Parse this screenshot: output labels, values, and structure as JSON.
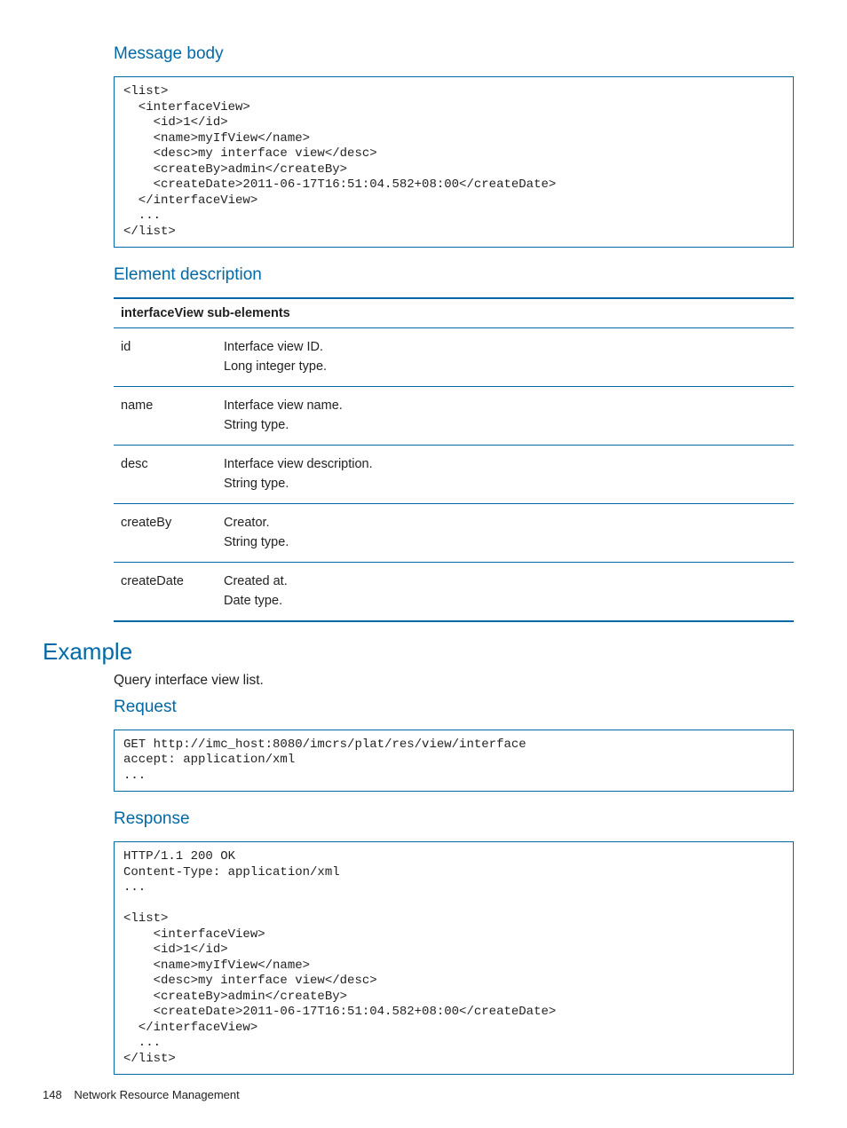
{
  "sections": {
    "msgBodyTitle": "Message body",
    "msgBodyCode": "<list>\n  <interfaceView>\n    <id>1</id>\n    <name>myIfView</name>\n    <desc>my interface view</desc>\n    <createBy>admin</createBy>\n    <createDate>2011-06-17T16:51:04.582+08:00</createDate>\n  </interfaceView>\n  ...\n</list>",
    "elemDescTitle": "Element description",
    "tableHeader": "interfaceView sub-elements",
    "rows": [
      {
        "k": "id",
        "v": "Interface view ID.\nLong integer type."
      },
      {
        "k": "name",
        "v": "Interface view name.\nString type."
      },
      {
        "k": "desc",
        "v": "Interface view description.\nString type."
      },
      {
        "k": "createBy",
        "v": "Creator.\nString type."
      },
      {
        "k": "createDate",
        "v": "Created at.\nDate type."
      }
    ],
    "exampleTitle": "Example",
    "exampleIntro": "Query interface view list.",
    "requestTitle": "Request",
    "requestCode": "GET http://imc_host:8080/imcrs/plat/res/view/interface\naccept: application/xml\n...",
    "responseTitle": "Response",
    "responseCode": "HTTP/1.1 200 OK\nContent-Type: application/xml\n...\n\n<list>\n    <interfaceView>\n    <id>1</id>\n    <name>myIfView</name>\n    <desc>my interface view</desc>\n    <createBy>admin</createBy>\n    <createDate>2011-06-17T16:51:04.582+08:00</createDate>\n  </interfaceView>\n  ...\n</list>"
  },
  "footer": {
    "page": "148",
    "chapter": "Network Resource Management"
  }
}
